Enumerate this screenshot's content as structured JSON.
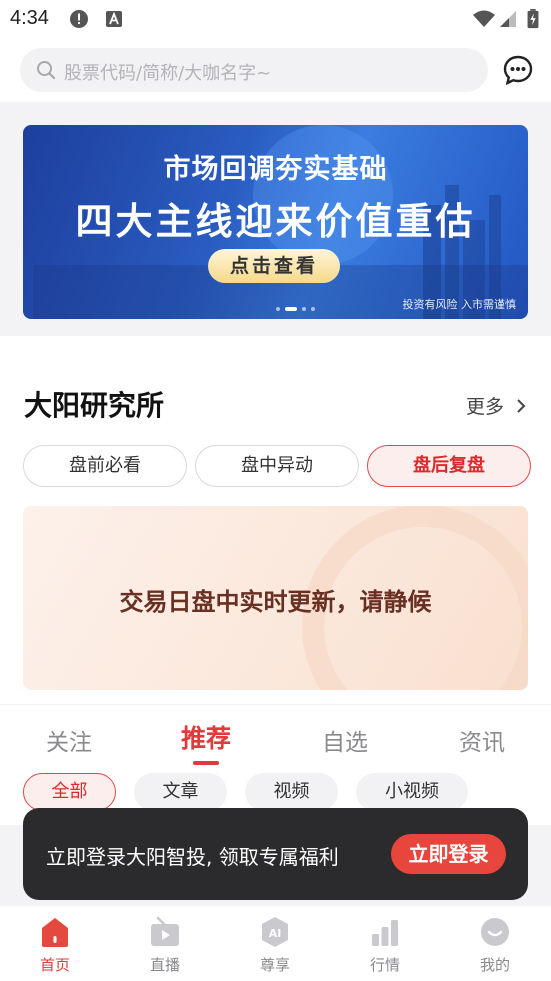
{
  "status_bar": {
    "time": "4:34"
  },
  "search": {
    "placeholder": "股票代码/简称/大咖名字~"
  },
  "banner": {
    "line1": "市场回调夯实基础",
    "line2": "四大主线迎来价值重估",
    "cta": "点击查看",
    "risk_notice": "投资有风险 入市需谨慎",
    "page_count": 4,
    "active_index": 0
  },
  "research": {
    "title": "大阳研究所",
    "more": "更多",
    "segments": [
      "盘前必看",
      "盘中异动",
      "盘后复盘"
    ],
    "active_segment": 2,
    "notice": "交易日盘中实时更新，请静候"
  },
  "feed": {
    "tabs": [
      "关注",
      "推荐",
      "自选",
      "资讯"
    ],
    "active_tab": 1,
    "chips": [
      "全部",
      "文章",
      "视频",
      "小视频"
    ],
    "active_chip": 0
  },
  "toast": {
    "message": "立即登录大阳智投, 领取专属福利",
    "button": "立即登录"
  },
  "bottom_nav": {
    "items": [
      {
        "label": "首页",
        "icon": "home-icon"
      },
      {
        "label": "直播",
        "icon": "live-icon"
      },
      {
        "label": "尊享",
        "icon": "ai-icon"
      },
      {
        "label": "行情",
        "icon": "market-icon"
      },
      {
        "label": "我的",
        "icon": "profile-icon"
      }
    ],
    "active_index": 0
  },
  "colors": {
    "accent": "#e03a3a",
    "toast_bg": "#2b2b2d",
    "banner_blue": "#2a5cc0"
  }
}
